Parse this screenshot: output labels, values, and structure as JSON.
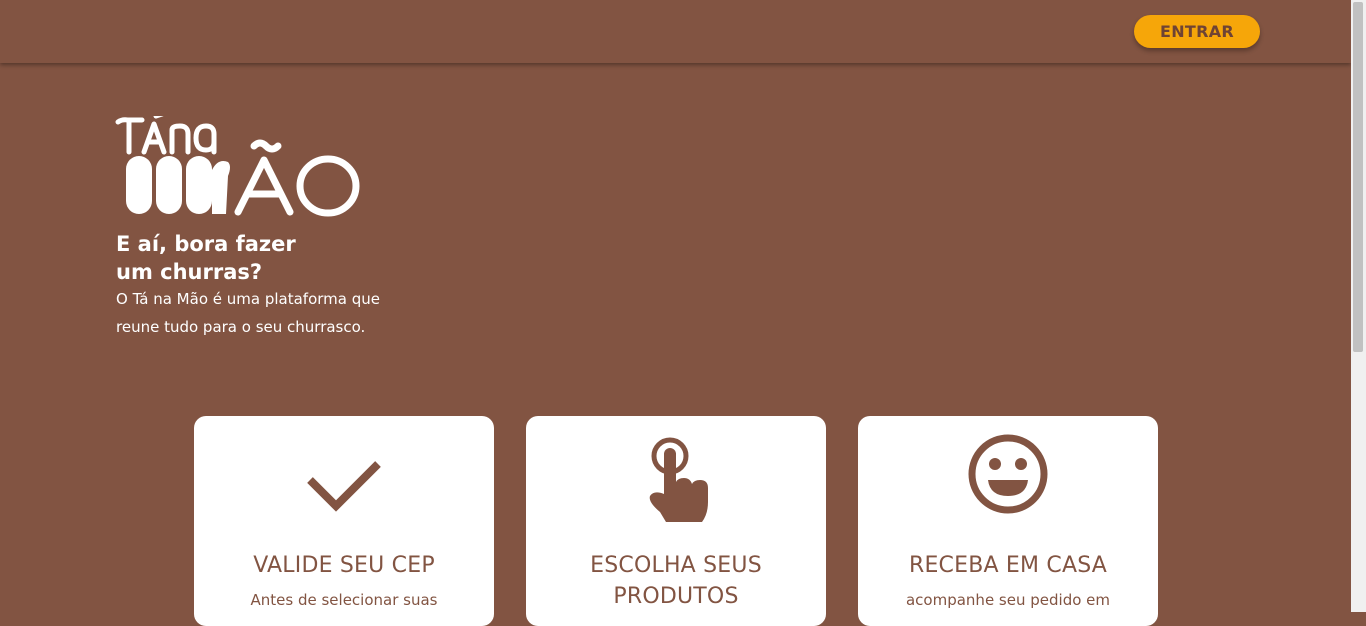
{
  "header": {
    "login_button": "ENTRAR"
  },
  "brand": {
    "logo_text": "TÁ NA MÃO",
    "logo_icon": "hand-fingers-logo"
  },
  "hero": {
    "title_line1": "E aí, bora fazer",
    "title_line2": "um churras?",
    "desc_line1": "O Tá na Mão é uma plataforma que",
    "desc_line2": "reune tudo para o seu churrasco."
  },
  "steps": [
    {
      "icon": "checkmark-icon",
      "title_line1": "VALIDE SEU CEP",
      "text": "Antes de selecionar suas"
    },
    {
      "icon": "pointing-hand-icon",
      "title_line1": "ESCOLHA SEUS",
      "title_line2": "PRODUTOS",
      "text": ""
    },
    {
      "icon": "smiley-face-icon",
      "title_line1": "RECEBA EM CASA",
      "text": "acompanhe seu pedido em"
    }
  ],
  "colors": {
    "background": "#825442",
    "accent": "#f6a609",
    "card": "#ffffff",
    "text_on_card": "#825442"
  }
}
